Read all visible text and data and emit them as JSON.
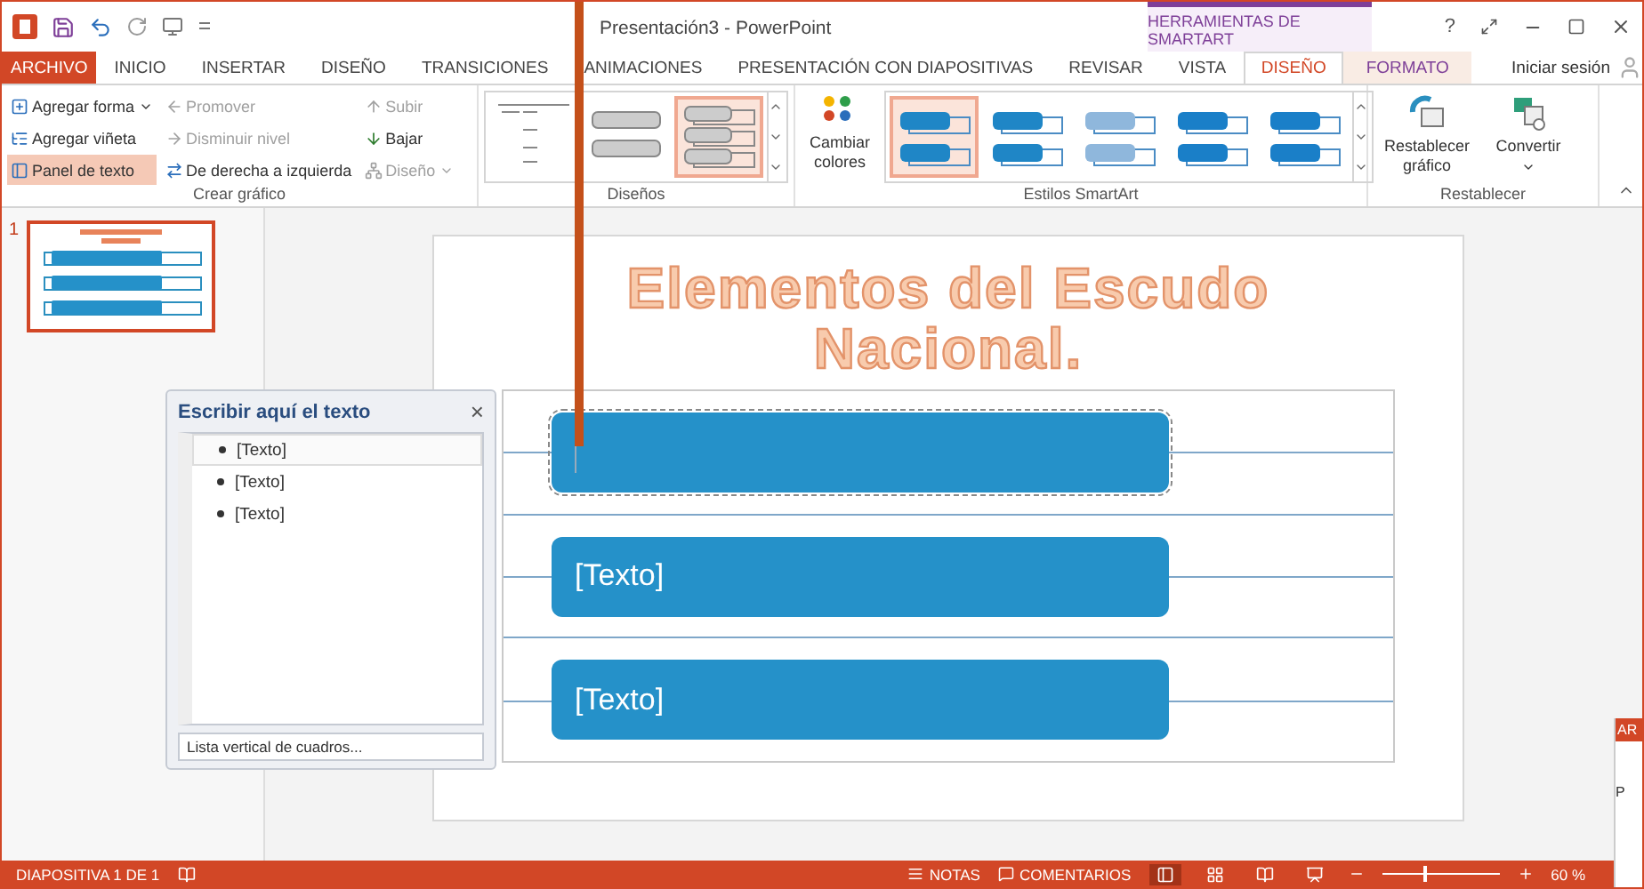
{
  "title_bar": {
    "title": "Presentación3 - PowerPoint",
    "contextual_header": "HERRAMIENTAS DE SMARTART",
    "help": "?"
  },
  "tabs": [
    {
      "label": "ARCHIVO",
      "kind": "file",
      "selected": false
    },
    {
      "label": "INICIO",
      "kind": "normal",
      "selected": false
    },
    {
      "label": "INSERTAR",
      "kind": "normal",
      "selected": false
    },
    {
      "label": "DISEÑO",
      "kind": "normal",
      "selected": false
    },
    {
      "label": "TRANSICIONES",
      "kind": "normal",
      "selected": false
    },
    {
      "label": "ANIMACIONES",
      "kind": "normal",
      "selected": false
    },
    {
      "label": "PRESENTACIÓN CON DIAPOSITIVAS",
      "kind": "normal",
      "selected": false
    },
    {
      "label": "REVISAR",
      "kind": "normal",
      "selected": false
    },
    {
      "label": "VISTA",
      "kind": "normal",
      "selected": false
    },
    {
      "label": "DISEÑO",
      "kind": "contextual",
      "selected": true
    },
    {
      "label": "FORMATO",
      "kind": "contextual",
      "selected": false
    }
  ],
  "sign_in": "Iniciar sesión",
  "ribbon": {
    "create": {
      "label": "Crear gráfico",
      "columns": [
        [
          {
            "label": "Agregar forma",
            "disabled": false,
            "selected": false,
            "dropdown": true
          },
          {
            "label": "Agregar viñeta",
            "disabled": false,
            "selected": false,
            "dropdown": false
          },
          {
            "label": "Panel de texto",
            "disabled": false,
            "selected": true,
            "dropdown": false
          }
        ],
        [
          {
            "label": "Promover",
            "disabled": true,
            "selected": false,
            "dropdown": false
          },
          {
            "label": "Disminuir nivel",
            "disabled": true,
            "selected": false,
            "dropdown": false
          },
          {
            "label": "De derecha a izquierda",
            "disabled": false,
            "selected": false,
            "dropdown": false
          }
        ],
        [
          {
            "label": "Subir",
            "disabled": true,
            "selected": false,
            "dropdown": false
          },
          {
            "label": "Bajar",
            "disabled": false,
            "selected": false,
            "dropdown": false
          },
          {
            "label": "Diseño",
            "disabled": true,
            "selected": false,
            "dropdown": true
          }
        ]
      ]
    },
    "layouts": {
      "label": "Diseños",
      "items": [
        {
          "kind": "list",
          "selected": false
        },
        {
          "kind": "stacked",
          "selected": false
        },
        {
          "kind": "boxes",
          "selected": true
        }
      ]
    },
    "styles": {
      "label": "Estilos SmartArt",
      "colors_button": "Cambiar colores",
      "items": [
        {
          "kind": "flat",
          "selected": true
        },
        {
          "kind": "flat",
          "selected": false
        },
        {
          "kind": "soft",
          "selected": false
        },
        {
          "kind": "gloss",
          "selected": false
        },
        {
          "kind": "gloss",
          "selected": false
        }
      ]
    },
    "reset": {
      "label": "Restablecer",
      "buttons": [
        {
          "label": "Restablecer gráfico",
          "dropdown": false
        },
        {
          "label": "Convertir",
          "dropdown": true
        }
      ]
    }
  },
  "slides": [
    {
      "number": "1",
      "selected": true
    }
  ],
  "slide": {
    "title": "Elementos del Escudo Nacional.",
    "shapes": [
      {
        "selected": true
      },
      {
        "text": "[Texto]",
        "selected": false
      },
      {
        "text": "[Texto]",
        "selected": false
      }
    ]
  },
  "text_pane": {
    "title": "Escribir aquí el texto",
    "close": "×",
    "items": [
      {
        "text": "[Texto]",
        "selected": true
      },
      {
        "text": "[Texto]",
        "selected": false
      },
      {
        "text": "[Texto]",
        "selected": false
      }
    ],
    "footer": "Lista vertical de cuadros..."
  },
  "status_bar": {
    "slide_info": "DIAPOSITIVA 1 DE 1",
    "notes": "NOTAS",
    "comments": "COMENTARIOS",
    "views": [
      {
        "kind": "normal",
        "selected": true
      },
      {
        "kind": "sorter",
        "selected": false
      },
      {
        "kind": "reading",
        "selected": false
      },
      {
        "kind": "show",
        "selected": false
      }
    ],
    "zoom": {
      "level": 0.36,
      "reading": "60 %"
    }
  },
  "other_window": {
    "tab": "AR",
    "text": "P"
  }
}
